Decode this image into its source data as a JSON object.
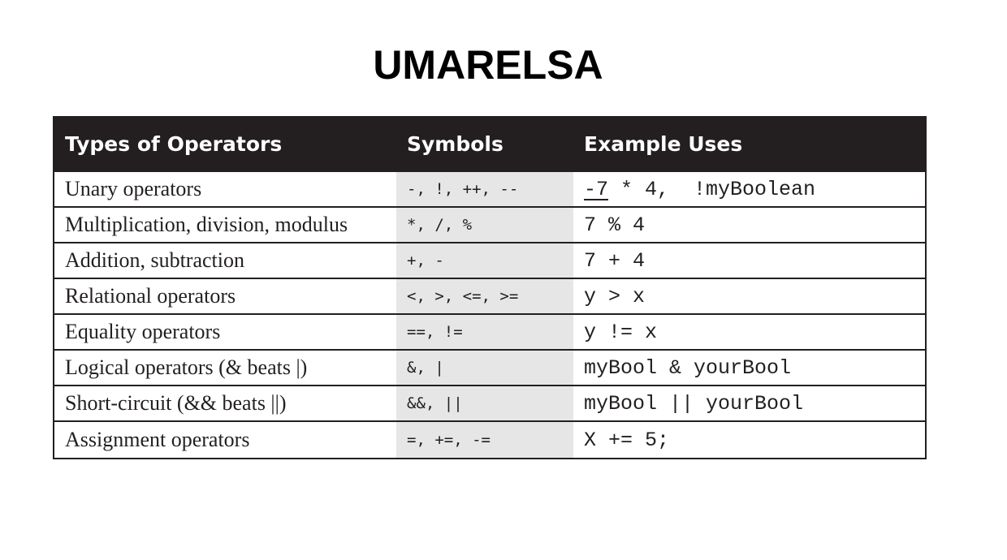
{
  "title": "UMARELSA",
  "table": {
    "headers": [
      "Types of Operators",
      "Symbols",
      "Example Uses"
    ],
    "rows": [
      {
        "type": "Unary operators",
        "symbols": "-, !, ++, --",
        "example_underlined": "-7",
        "example_rest": " * 4,  !myBoolean"
      },
      {
        "type": "Multiplication, division, modulus",
        "symbols": "*, /, %",
        "example_underlined": "",
        "example_rest": "7 % 4"
      },
      {
        "type": "Addition, subtraction",
        "symbols": "+, -",
        "example_underlined": "",
        "example_rest": "7 + 4"
      },
      {
        "type": "Relational operators",
        "symbols": "<, >, <=, >=",
        "example_underlined": "",
        "example_rest": "y > x"
      },
      {
        "type": "Equality operators",
        "symbols": "==, !=",
        "example_underlined": "",
        "example_rest": "y != x"
      },
      {
        "type": "Logical operators (& beats |)",
        "symbols": "&, |",
        "example_underlined": "",
        "example_rest": "myBool & yourBool"
      },
      {
        "type": "Short-circuit (&& beats ||)",
        "symbols": "&&, ||",
        "example_underlined": "",
        "example_rest": "myBool || yourBool"
      },
      {
        "type": "Assignment operators",
        "symbols": "=, +=, -=",
        "example_underlined": "",
        "example_rest": "X += 5;"
      }
    ]
  }
}
